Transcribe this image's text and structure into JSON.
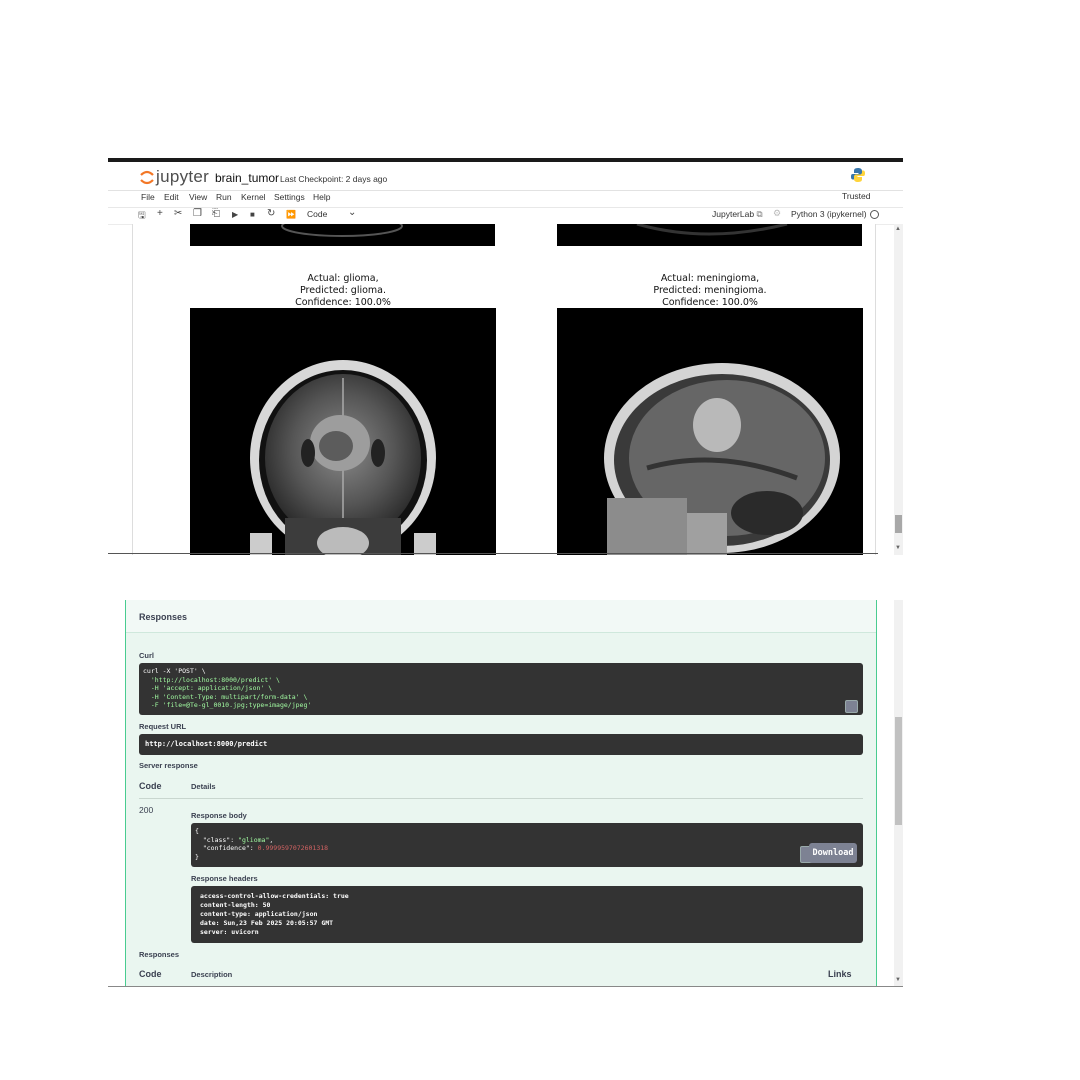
{
  "notebook": {
    "brand": "jupyter",
    "title": "brain_tumor",
    "checkpoint": "Last Checkpoint: 2 days ago",
    "trusted": "Trusted",
    "menu": [
      "File",
      "Edit",
      "View",
      "Run",
      "Kernel",
      "Settings",
      "Help"
    ],
    "toolbar": {
      "cell_type": "Code",
      "jupyterlab": "JupyterLab",
      "kernel": "Python 3 (ipykernel)"
    },
    "predictions": [
      {
        "actual": "Actual: glioma,",
        "predicted": "Predicted: glioma.",
        "confidence": "Confidence: 100.0%"
      },
      {
        "actual": "Actual: meningioma,",
        "predicted": "Predicted: meningioma.",
        "confidence": "Confidence: 100.0%"
      }
    ]
  },
  "api": {
    "responses_title": "Responses",
    "curl_label": "Curl",
    "curl_lines": [
      "curl -X 'POST' \\",
      "  'http://localhost:8000/predict' \\",
      "  -H 'accept: application/json' \\",
      "  -H 'Content-Type: multipart/form-data' \\",
      "  -F 'file=@Te-gl_0010.jpg;type=image/jpeg'"
    ],
    "request_url_label": "Request URL",
    "request_url": "http://localhost:8000/predict",
    "server_response_label": "Server response",
    "code_header": "Code",
    "details_header": "Details",
    "status_code": "200",
    "response_body_label": "Response body",
    "body": {
      "open": "{",
      "class_key": "\"class\": ",
      "class_value": "\"glioma\"",
      "confidence_key": "\"confidence\": ",
      "confidence_value": "0.9999597072601318",
      "close": "}"
    },
    "download_label": "Download",
    "response_headers_label": "Response headers",
    "headers": [
      "access-control-allow-credentials: true",
      "content-length: 50",
      "content-type: application/json",
      "date: Sun,23 Feb 2025 20:05:57 GMT",
      "server: uvicorn"
    ],
    "responses_label_2": "Responses",
    "code_header_2": "Code",
    "description_header": "Description",
    "links_header": "Links"
  },
  "colors": {
    "swagger_bg": "#eaf6f0",
    "swagger_border": "#49cc90",
    "code_bg": "#333333",
    "string_green": "#a2fca2",
    "number_red": "#d36363",
    "jupyter_orange": "#f37726"
  }
}
